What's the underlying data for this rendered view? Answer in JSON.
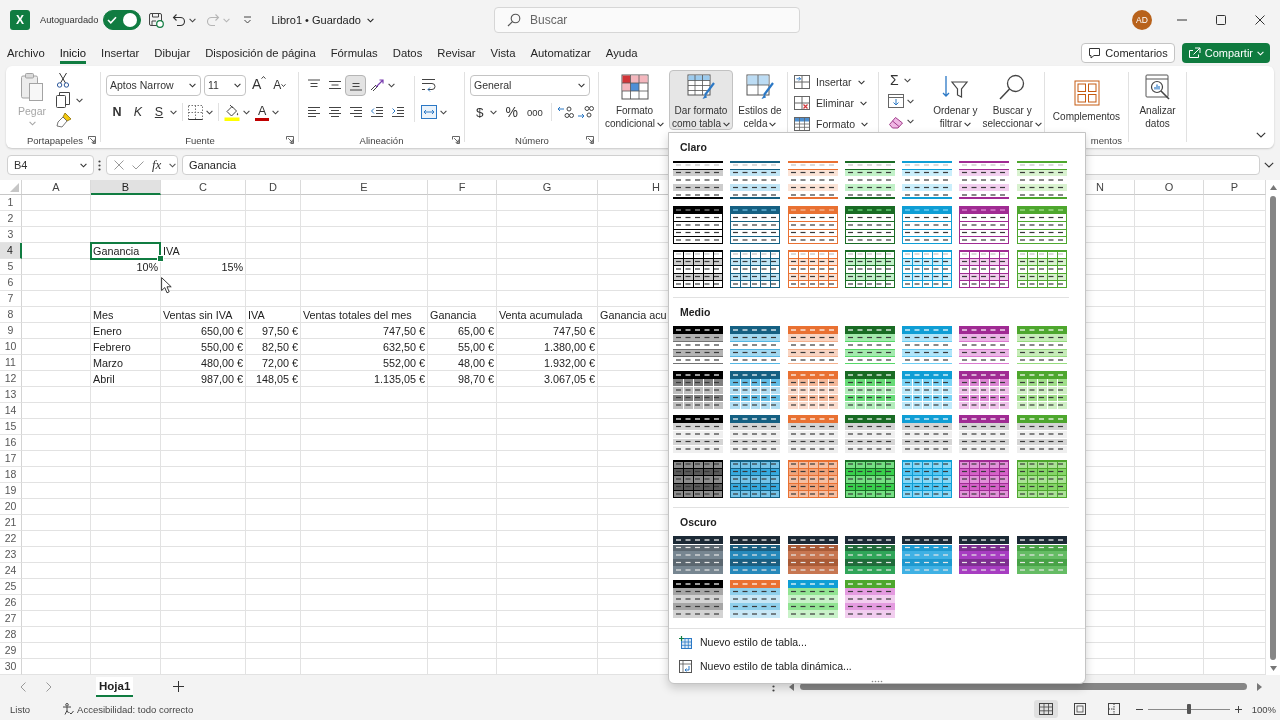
{
  "title_bar": {
    "logo": "X",
    "autosave": {
      "label": "Autoguardado",
      "on": true
    },
    "redo": {
      "disabled": true
    },
    "title": "Libro1 • Guardado",
    "search": {
      "placeholder": "Buscar"
    },
    "avatar": "AD"
  },
  "menu_tabs": [
    {
      "label": "Archivo",
      "selected": false
    },
    {
      "label": "Inicio",
      "selected": true
    },
    {
      "label": "Insertar",
      "selected": false
    },
    {
      "label": "Dibujar",
      "selected": false
    },
    {
      "label": "Disposición de página",
      "selected": false
    },
    {
      "label": "Fórmulas",
      "selected": false
    },
    {
      "label": "Datos",
      "selected": false
    },
    {
      "label": "Revisar",
      "selected": false
    },
    {
      "label": "Vista",
      "selected": false
    },
    {
      "label": "Automatizar",
      "selected": false
    },
    {
      "label": "Ayuda",
      "selected": false
    }
  ],
  "header_buttons": {
    "comments": "Comentarios",
    "share": "Compartir"
  },
  "ribbon": {
    "clipboard": {
      "paste": {
        "label": "Pegar",
        "disabled": true
      },
      "label": "Portapapeles"
    },
    "font": {
      "name": "Aptos Narrow",
      "size": "11",
      "grow": "A",
      "shrink": "A",
      "bold": "N",
      "italic": "K",
      "underline": "S",
      "color_button": "A",
      "label": "Fuente"
    },
    "alignment": {
      "vertical": [
        {
          "selected": false
        },
        {
          "selected": false
        },
        {
          "selected": true
        }
      ],
      "label": "Alineación"
    },
    "number": {
      "format": "General",
      "currency": "$",
      "percent": "%",
      "thousands": "000",
      "label": "Número"
    },
    "styles": [
      {
        "label": "Formato condicional",
        "expanded": false
      },
      {
        "label": "Dar formato como tabla",
        "expanded": true
      },
      {
        "label": "Estilos de celda",
        "expanded": false
      }
    ],
    "cells": [
      "Insertar",
      "Eliminar",
      "Formato"
    ],
    "editing": {
      "autosum": "Σ",
      "buttons": [
        "Ordenar y filtrar",
        "Buscar y seleccionar"
      ]
    },
    "add_ins": {
      "button": "Complementos",
      "group_label": "mentos"
    },
    "analysis": {
      "button": "Analizar datos"
    }
  },
  "formula_bar": {
    "name_box": "B4",
    "function_label": "fx",
    "formula": "Ganancia"
  },
  "sheet": {
    "columns_left": [
      {
        "label": "A",
        "selected": false
      },
      {
        "label": "B",
        "selected": true
      },
      {
        "label": "C",
        "selected": false
      },
      {
        "label": "D",
        "selected": false
      },
      {
        "label": "E",
        "selected": false
      },
      {
        "label": "F",
        "selected": false
      },
      {
        "label": "G",
        "selected": false
      },
      {
        "label": "H",
        "selected": false
      }
    ],
    "columns_right": [
      {
        "label": "N",
        "selected": false
      },
      {
        "label": "O",
        "selected": false
      },
      {
        "label": "P",
        "selected": false
      }
    ],
    "rows": [
      {
        "label": "1",
        "selected": false
      },
      {
        "label": "2",
        "selected": false
      },
      {
        "label": "3",
        "selected": false
      },
      {
        "label": "4",
        "selected": true,
        "cells": [
          {
            "text": "Ganancia",
            "kind": "text",
            "selected": true
          },
          {
            "text": "IVA",
            "kind": "text",
            "selected": false
          }
        ]
      },
      {
        "label": "5",
        "selected": false,
        "cells": [
          {
            "text": "10%",
            "kind": "number",
            "selected": false
          },
          {
            "text": "15%",
            "kind": "number",
            "selected": false
          }
        ]
      },
      {
        "label": "6",
        "selected": false
      },
      {
        "label": "7",
        "selected": false
      },
      {
        "label": "8",
        "selected": false,
        "cells": [
          {
            "text": "Mes",
            "kind": "text",
            "selected": false
          },
          {
            "text": "Ventas sin IVA",
            "kind": "text",
            "selected": false
          },
          {
            "text": "IVA",
            "kind": "text",
            "selected": false
          },
          {
            "text": "Ventas totales del mes",
            "kind": "text",
            "selected": false
          },
          {
            "text": "Ganancia",
            "kind": "text",
            "selected": false
          },
          {
            "text": "Venta acumulada",
            "kind": "text",
            "selected": false
          },
          {
            "text": "Ganancia acu",
            "kind": "text",
            "selected": false
          }
        ]
      },
      {
        "label": "9",
        "selected": false,
        "cells": [
          {
            "text": "Enero",
            "kind": "text",
            "selected": false
          },
          {
            "text": "650,00 €",
            "kind": "number",
            "selected": false
          },
          {
            "text": "97,50 €",
            "kind": "number",
            "selected": false
          },
          {
            "text": "747,50 €",
            "kind": "number",
            "selected": false
          },
          {
            "text": "65,00 €",
            "kind": "number",
            "selected": false
          },
          {
            "text": "747,50 €",
            "kind": "number",
            "selected": false
          }
        ]
      },
      {
        "label": "10",
        "selected": false,
        "cells": [
          {
            "text": "Febrero",
            "kind": "text",
            "selected": false
          },
          {
            "text": "550,00 €",
            "kind": "number",
            "selected": false
          },
          {
            "text": "82,50 €",
            "kind": "number",
            "selected": false
          },
          {
            "text": "632,50 €",
            "kind": "number",
            "selected": false
          },
          {
            "text": "55,00 €",
            "kind": "number",
            "selected": false
          },
          {
            "text": "1.380,00 €",
            "kind": "number",
            "selected": false
          }
        ]
      },
      {
        "label": "11",
        "selected": false,
        "cells": [
          {
            "text": "Marzo",
            "kind": "text",
            "selected": false
          },
          {
            "text": "480,00 €",
            "kind": "number",
            "selected": false
          },
          {
            "text": "72,00 €",
            "kind": "number",
            "selected": false
          },
          {
            "text": "552,00 €",
            "kind": "number",
            "selected": false
          },
          {
            "text": "48,00 €",
            "kind": "number",
            "selected": false
          },
          {
            "text": "1.932,00 €",
            "kind": "number",
            "selected": false
          }
        ]
      },
      {
        "label": "12",
        "selected": false,
        "cells": [
          {
            "text": "Abril",
            "kind": "text",
            "selected": false
          },
          {
            "text": "987,00 €",
            "kind": "number",
            "selected": false
          },
          {
            "text": "148,05 €",
            "kind": "number",
            "selected": false
          },
          {
            "text": "1.135,05 €",
            "kind": "number",
            "selected": false
          },
          {
            "text": "98,70 €",
            "kind": "number",
            "selected": false
          },
          {
            "text": "3.067,05 €",
            "kind": "number",
            "selected": false
          }
        ]
      },
      {
        "label": "13",
        "selected": false
      },
      {
        "label": "14",
        "selected": false
      },
      {
        "label": "15",
        "selected": false
      },
      {
        "label": "16",
        "selected": false
      },
      {
        "label": "17",
        "selected": false
      },
      {
        "label": "18",
        "selected": false
      },
      {
        "label": "19",
        "selected": false
      },
      {
        "label": "20",
        "selected": false
      },
      {
        "label": "21",
        "selected": false
      },
      {
        "label": "22",
        "selected": false
      },
      {
        "label": "23",
        "selected": false
      },
      {
        "label": "24",
        "selected": false
      },
      {
        "label": "25",
        "selected": false
      },
      {
        "label": "26",
        "selected": false
      },
      {
        "label": "27",
        "selected": false
      },
      {
        "label": "28",
        "selected": false
      },
      {
        "label": "29",
        "selected": false
      },
      {
        "label": "30",
        "selected": false
      }
    ]
  },
  "table_styles": {
    "sections": [
      {
        "title": "Claro",
        "rows": [
          {
            "kind": "light-banded",
            "styles": [
              {
                "color": "#000000"
              },
              {
                "color": "#156082"
              },
              {
                "color": "#e97132"
              },
              {
                "color": "#196b24"
              },
              {
                "color": "#0f9ed5"
              },
              {
                "color": "#a02b93"
              },
              {
                "color": "#4ea72e"
              }
            ]
          },
          {
            "kind": "light-header",
            "styles": [
              {
                "color": "#000000"
              },
              {
                "color": "#156082"
              },
              {
                "color": "#e97132"
              },
              {
                "color": "#196b24"
              },
              {
                "color": "#0f9ed5"
              },
              {
                "color": "#a02b93"
              },
              {
                "color": "#4ea72e"
              }
            ]
          },
          {
            "kind": "light-grid",
            "styles": [
              {
                "color": "#000000"
              },
              {
                "color": "#156082"
              },
              {
                "color": "#e97132"
              },
              {
                "color": "#196b24"
              },
              {
                "color": "#0f9ed5"
              },
              {
                "color": "#a02b93"
              },
              {
                "color": "#4ea72e"
              }
            ]
          }
        ]
      },
      {
        "title": "Medio",
        "rows": [
          {
            "kind": "medium-banded",
            "styles": [
              {
                "color": "#000000"
              },
              {
                "color": "#156082"
              },
              {
                "color": "#e97132"
              },
              {
                "color": "#196b24"
              },
              {
                "color": "#0f9ed5"
              },
              {
                "color": "#a02b93"
              },
              {
                "color": "#4ea72e"
              }
            ]
          },
          {
            "kind": "medium-grid",
            "styles": [
              {
                "color": "#000000"
              },
              {
                "color": "#156082"
              },
              {
                "color": "#e97132"
              },
              {
                "color": "#196b24"
              },
              {
                "color": "#0f9ed5"
              },
              {
                "color": "#a02b93"
              },
              {
                "color": "#4ea72e"
              }
            ]
          },
          {
            "kind": "medium-gray",
            "styles": [
              {
                "color": "#000000"
              },
              {
                "color": "#156082"
              },
              {
                "color": "#e97132"
              },
              {
                "color": "#196b24"
              },
              {
                "color": "#0f9ed5"
              },
              {
                "color": "#a02b93"
              },
              {
                "color": "#4ea72e"
              }
            ]
          },
          {
            "kind": "medium-grid-strong",
            "styles": [
              {
                "color": "#000000"
              },
              {
                "color": "#156082"
              },
              {
                "color": "#e97132"
              },
              {
                "color": "#196b24"
              },
              {
                "color": "#0f9ed5"
              },
              {
                "color": "#a02b93"
              },
              {
                "color": "#4ea72e"
              }
            ]
          }
        ]
      },
      {
        "title": "Oscuro",
        "rows": [
          {
            "kind": "dark",
            "styles": [
              {
                "color": "#5b6770"
              },
              {
                "color": "#1b5e80"
              },
              {
                "color": "#a85a36"
              },
              {
                "color": "#1f6b3a"
              },
              {
                "color": "#1d98cf"
              },
              {
                "color": "#7d2e90"
              },
              {
                "color": "#47a246"
              }
            ]
          },
          {
            "kind": "dark-mixed",
            "styles": [
              {
                "color": "#000000",
                "body": {
                  "color": "#a6a6a6"
                }
              },
              {
                "color": "#e97132",
                "body": {
                  "color": "#8fd0ec"
                }
              },
              {
                "color": "#0f9ed5",
                "body": {
                  "color": "#92e493"
                }
              },
              {
                "color": "#4ea72e",
                "body": {
                  "color": "#e49be0"
                }
              }
            ]
          }
        ]
      }
    ],
    "actions": [
      "Nuevo estilo de tabla...",
      "Nuevo estilo de tabla dinámica..."
    ]
  },
  "sheet_tabs": [
    {
      "label": "Hoja1",
      "selected": true
    }
  ],
  "status_bar": {
    "status": "Listo",
    "accessibility": "Accesibilidad: todo correcto",
    "views": [
      {
        "selected": true
      },
      {
        "selected": false
      },
      {
        "selected": false
      }
    ],
    "zoom": {
      "level": 0.5,
      "label": "100%"
    }
  }
}
